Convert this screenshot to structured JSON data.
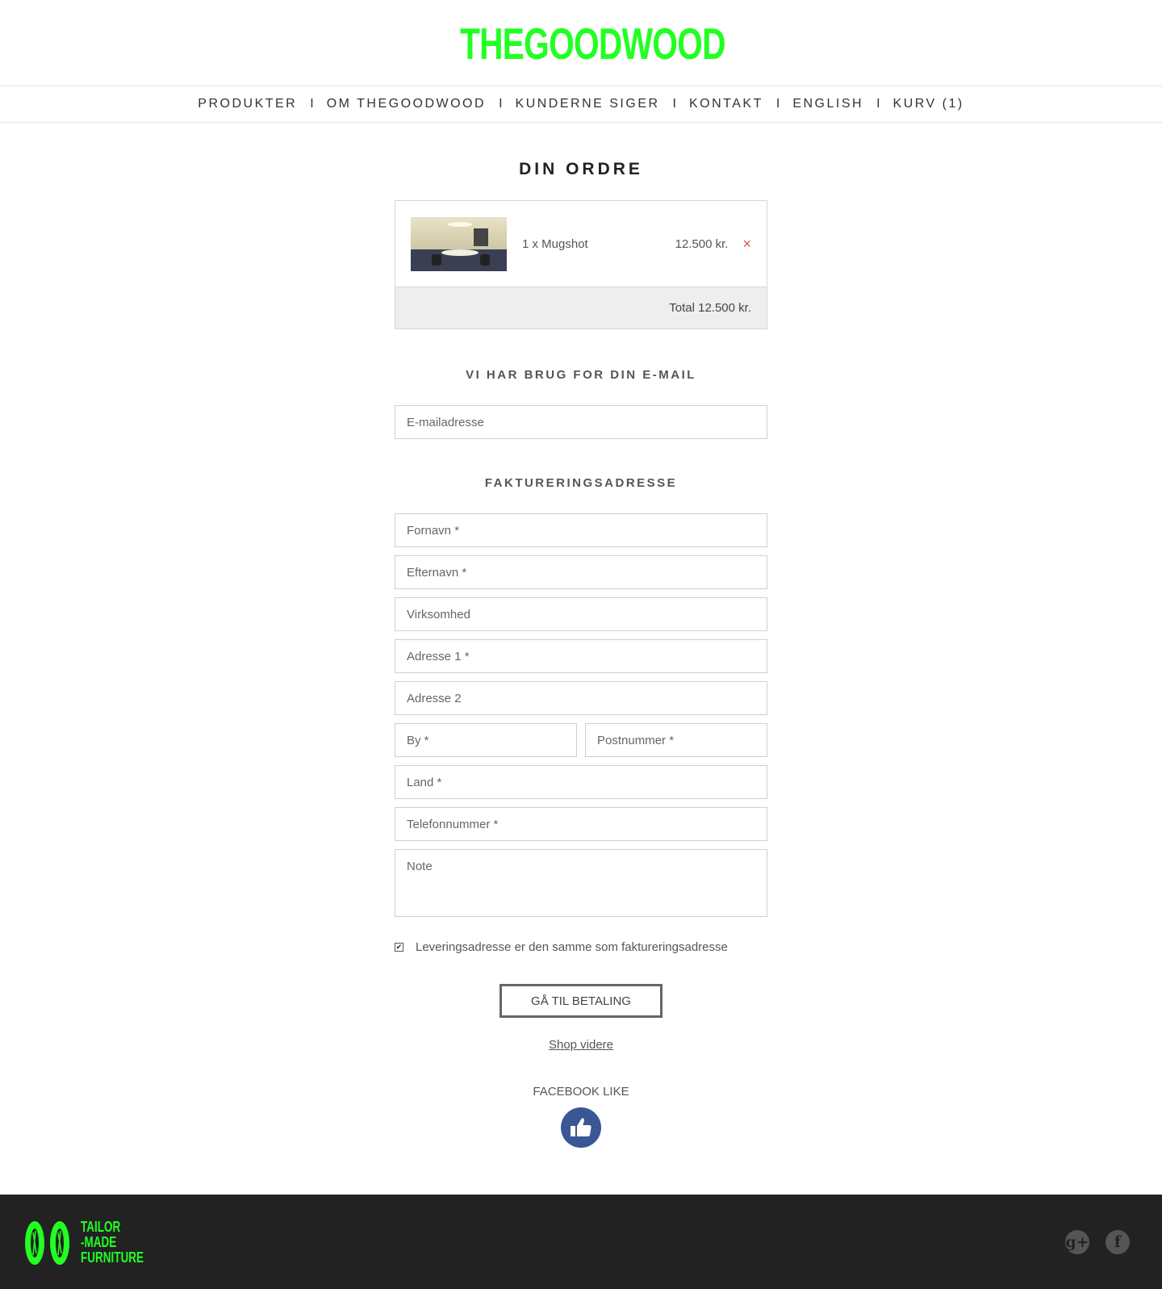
{
  "brand": {
    "logo_text": "THEGOODWOOD"
  },
  "nav": [
    {
      "label": "PRODUKTER"
    },
    {
      "label": "OM THEGOODWOOD"
    },
    {
      "label": "KUNDERNE SIGER"
    },
    {
      "label": "KONTAKT"
    },
    {
      "label": "ENGLISH"
    },
    {
      "label": "KURV (1)"
    }
  ],
  "nav_separator": "I",
  "order": {
    "title": "DIN ORDRE",
    "item": {
      "name": "1 x Mugshot",
      "price": "12.500 kr.",
      "remove_icon": "×"
    },
    "total": "Total 12.500 kr."
  },
  "email_section": {
    "heading": "VI HAR BRUG FOR DIN E-MAIL",
    "email_placeholder": "E-mailadresse"
  },
  "billing": {
    "heading": "FAKTURERINGSADRESSE",
    "fornavn": "Fornavn *",
    "efternavn": "Efternavn *",
    "virksomhed": "Virksomhed",
    "adresse1": "Adresse 1 *",
    "adresse2": "Adresse 2",
    "by": "By *",
    "postnummer": "Postnummer *",
    "land": "Land *",
    "telefon": "Telefonnummer *",
    "note": "Note"
  },
  "same_address": {
    "label": "Leveringsadresse er den samme som faktureringsadresse",
    "checked": true,
    "check_glyph": "✔"
  },
  "pay_button": "GÅ TIL BETALING",
  "shop_link": "Shop videre",
  "facebook": {
    "label": "FACEBOOK LIKE",
    "icon": "thumbs-up-icon"
  },
  "footer": {
    "tagline": [
      "TAILOR",
      "-MADE",
      "FURNITURE"
    ],
    "social": [
      {
        "icon": "google-plus-icon",
        "glyph": "g+"
      },
      {
        "icon": "facebook-icon",
        "glyph": "f"
      }
    ]
  },
  "colors": {
    "brand_green": "#22ff22",
    "remove_red": "#e05252",
    "footer_bg": "#222222",
    "facebook_blue": "#3a5795"
  }
}
